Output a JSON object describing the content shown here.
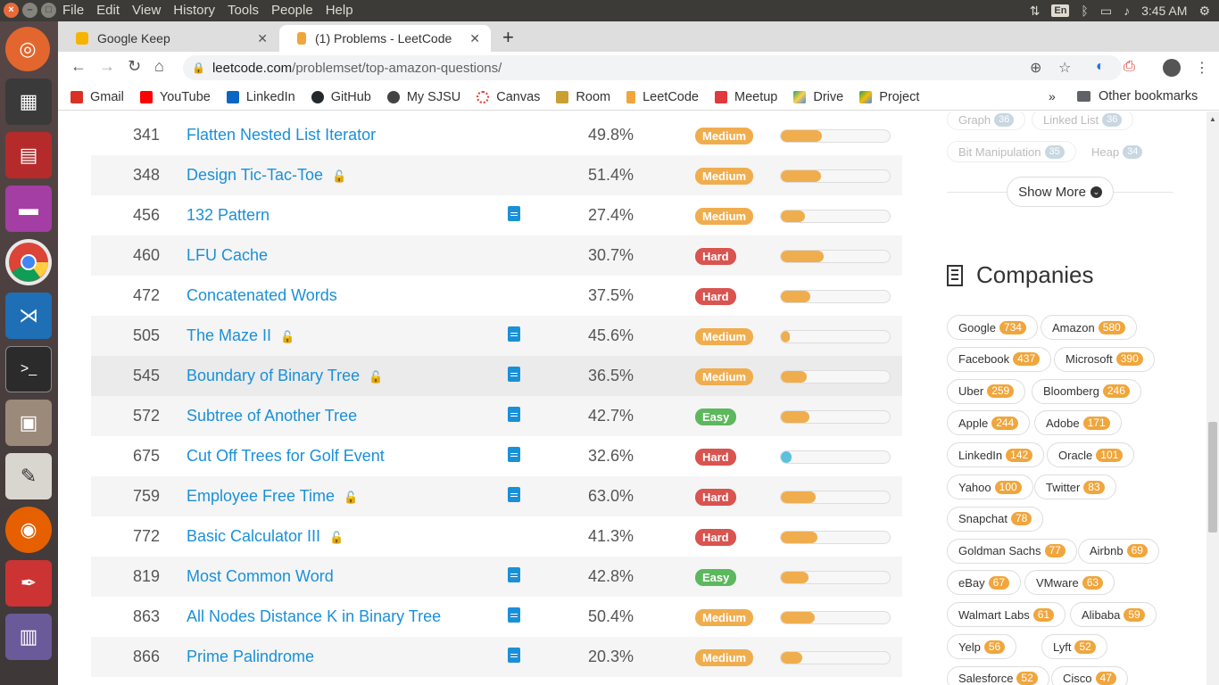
{
  "system": {
    "menu": [
      "File",
      "Edit",
      "View",
      "History",
      "Tools",
      "People",
      "Help"
    ],
    "lang": "En",
    "time": "3:45 AM"
  },
  "tabs": [
    {
      "title": "Google Keep",
      "color": "#f6b400"
    },
    {
      "title": "(1) Problems - LeetCode",
      "color": "#f0a63c"
    }
  ],
  "address": {
    "host": "leetcode.com",
    "path": "/problemset/top-amazon-questions/"
  },
  "bookmarks": [
    {
      "label": "Gmail",
      "color": "#d93025"
    },
    {
      "label": "YouTube",
      "color": "#ff0000"
    },
    {
      "label": "LinkedIn",
      "color": "#0a66c2"
    },
    {
      "label": "GitHub",
      "color": "#24292e"
    },
    {
      "label": "My SJSU",
      "color": "#444444"
    },
    {
      "label": "Canvas",
      "color": "#e13f2b"
    },
    {
      "label": "Room",
      "color": "#c8a033"
    },
    {
      "label": "LeetCode",
      "color": "#f0a63c"
    },
    {
      "label": "Meetup",
      "color": "#e0393e"
    },
    {
      "label": "Drive",
      "color": "#1fa463"
    },
    {
      "label": "Project",
      "color": "#fbbc04"
    }
  ],
  "bookmarks_more": "»",
  "bookmarks_other": "Other bookmarks",
  "problems": [
    {
      "id": "341",
      "title": "Flatten Nested List Iterator",
      "locked": false,
      "solution": false,
      "acceptance": "49.8%",
      "difficulty": "Medium",
      "frequency": 0.38,
      "freq_color": "#f0ad4e"
    },
    {
      "id": "348",
      "title": "Design Tic-Tac-Toe",
      "locked": true,
      "solution": false,
      "acceptance": "51.4%",
      "difficulty": "Medium",
      "frequency": 0.37,
      "freq_color": "#f0ad4e"
    },
    {
      "id": "456",
      "title": "132 Pattern",
      "locked": false,
      "solution": true,
      "acceptance": "27.4%",
      "difficulty": "Medium",
      "frequency": 0.22,
      "freq_color": "#f0ad4e"
    },
    {
      "id": "460",
      "title": "LFU Cache",
      "locked": false,
      "solution": false,
      "acceptance": "30.7%",
      "difficulty": "Hard",
      "frequency": 0.39,
      "freq_color": "#f0ad4e"
    },
    {
      "id": "472",
      "title": "Concatenated Words",
      "locked": false,
      "solution": false,
      "acceptance": "37.5%",
      "difficulty": "Hard",
      "frequency": 0.27,
      "freq_color": "#f0ad4e"
    },
    {
      "id": "505",
      "title": "The Maze II",
      "locked": true,
      "solution": true,
      "acceptance": "45.6%",
      "difficulty": "Medium",
      "frequency": 0.01,
      "freq_color": "#f0ad4e"
    },
    {
      "id": "545",
      "title": "Boundary of Binary Tree",
      "locked": true,
      "solution": true,
      "acceptance": "36.5%",
      "difficulty": "Medium",
      "frequency": 0.24,
      "freq_color": "#f0ad4e"
    },
    {
      "id": "572",
      "title": "Subtree of Another Tree",
      "locked": false,
      "solution": true,
      "acceptance": "42.7%",
      "difficulty": "Easy",
      "frequency": 0.26,
      "freq_color": "#f0ad4e"
    },
    {
      "id": "675",
      "title": "Cut Off Trees for Golf Event",
      "locked": false,
      "solution": true,
      "acceptance": "32.6%",
      "difficulty": "Hard",
      "frequency": 0.1,
      "freq_color": "#5bc0de"
    },
    {
      "id": "759",
      "title": "Employee Free Time",
      "locked": true,
      "solution": true,
      "acceptance": "63.0%",
      "difficulty": "Hard",
      "frequency": 0.32,
      "freq_color": "#f0ad4e"
    },
    {
      "id": "772",
      "title": "Basic Calculator III",
      "locked": true,
      "solution": false,
      "acceptance": "41.3%",
      "difficulty": "Hard",
      "frequency": 0.34,
      "freq_color": "#f0ad4e"
    },
    {
      "id": "819",
      "title": "Most Common Word",
      "locked": false,
      "solution": true,
      "acceptance": "42.8%",
      "difficulty": "Easy",
      "frequency": 0.25,
      "freq_color": "#f0ad4e"
    },
    {
      "id": "863",
      "title": "All Nodes Distance K in Binary Tree",
      "locked": false,
      "solution": true,
      "acceptance": "50.4%",
      "difficulty": "Medium",
      "frequency": 0.31,
      "freq_color": "#f0ad4e"
    },
    {
      "id": "866",
      "title": "Prime Palindrome",
      "locked": false,
      "solution": true,
      "acceptance": "20.3%",
      "difficulty": "Medium",
      "frequency": 0.2,
      "freq_color": "#f0ad4e"
    }
  ],
  "difficulty_colors": {
    "Easy": "#5cb85c",
    "Medium": "#f0ad4e",
    "Hard": "#d9534f"
  },
  "tags": [
    {
      "name": "Graph",
      "count": "36"
    },
    {
      "name": "Linked List",
      "count": "36"
    },
    {
      "name": "Bit Manipulation",
      "count": "35"
    },
    {
      "name": "Heap",
      "count": "34"
    }
  ],
  "show_more": "Show More",
  "companies_title": "Companies",
  "companies": [
    {
      "name": "Google",
      "count": "734"
    },
    {
      "name": "Amazon",
      "count": "580"
    },
    {
      "name": "Facebook",
      "count": "437"
    },
    {
      "name": "Microsoft",
      "count": "390"
    },
    {
      "name": "Uber",
      "count": "259"
    },
    {
      "name": "Bloomberg",
      "count": "246"
    },
    {
      "name": "Apple",
      "count": "244"
    },
    {
      "name": "Adobe",
      "count": "171"
    },
    {
      "name": "LinkedIn",
      "count": "142"
    },
    {
      "name": "Oracle",
      "count": "101"
    },
    {
      "name": "Yahoo",
      "count": "100"
    },
    {
      "name": "Twitter",
      "count": "83"
    },
    {
      "name": "Snapchat",
      "count": "78"
    },
    {
      "name": "Goldman Sachs",
      "count": "77"
    },
    {
      "name": "Airbnb",
      "count": "69"
    },
    {
      "name": "eBay",
      "count": "67"
    },
    {
      "name": "VMware",
      "count": "63"
    },
    {
      "name": "Walmart Labs",
      "count": "61"
    },
    {
      "name": "Alibaba",
      "count": "59"
    },
    {
      "name": "Yelp",
      "count": "56"
    },
    {
      "name": "Lyft",
      "count": "52"
    },
    {
      "name": "Salesforce",
      "count": "52"
    },
    {
      "name": "Cisco",
      "count": "47"
    }
  ]
}
